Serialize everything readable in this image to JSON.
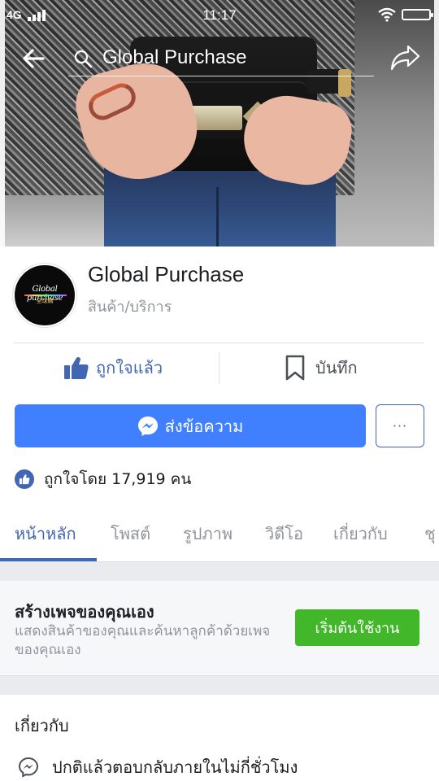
{
  "status_bar": {
    "network": "4G",
    "time": "11:17"
  },
  "top_nav": {
    "search_text": "Global Purchase"
  },
  "page": {
    "name": "Global Purchase",
    "category": "สินค้า/บริการ",
    "avatar_logo_text": "Global purchase",
    "avatar_logo_subtext": "全球購"
  },
  "actions": {
    "like_label": "ถูกใจแล้ว",
    "save_label": "บันทึก",
    "message_label": "ส่งข้อความ",
    "more_label": "···"
  },
  "likes": {
    "text": "ถูกใจโดย 17,919 คน"
  },
  "tabs": [
    {
      "label": "หน้าหลัก",
      "active": true
    },
    {
      "label": "โพสต์",
      "active": false
    },
    {
      "label": "รูปภาพ",
      "active": false
    },
    {
      "label": "วิดีโอ",
      "active": false
    },
    {
      "label": "เกี่ยวกับ",
      "active": false
    },
    {
      "label": "ชุ",
      "active": false
    }
  ],
  "create_page": {
    "title": "สร้างเพจของคุณเอง",
    "description": "แสดงสินค้าของคุณและค้นหาลูกค้าด้วยเพจของคุณเอง",
    "button_label": "เริ่มต้นใช้งาน"
  },
  "about": {
    "title": "เกี่ยวกับ",
    "response_text": "ปกติแล้วตอบกลับภายในไม่กี่ชั่วโมง"
  },
  "colors": {
    "facebook_blue": "#4267b2",
    "messenger_blue": "#4080ff",
    "green": "#42b72a",
    "gray_text": "#90949c"
  },
  "icons": [
    "back-arrow-icon",
    "search-icon",
    "share-icon",
    "thumbs-up-icon",
    "bookmark-icon",
    "messenger-icon",
    "more-icon",
    "like-badge-icon",
    "signal-icon",
    "wifi-icon",
    "battery-icon"
  ]
}
